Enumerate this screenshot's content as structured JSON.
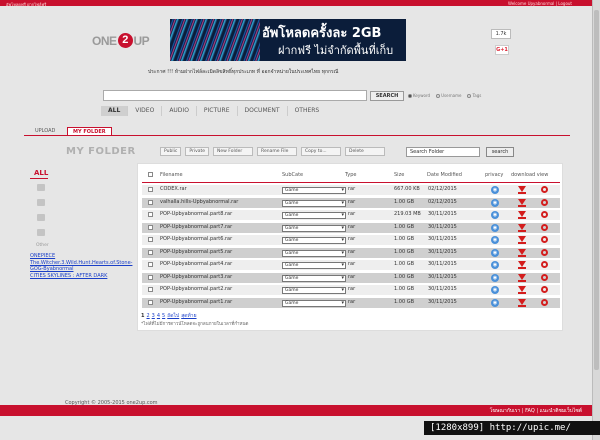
{
  "topbar": {
    "left_text": "อัพโหลดฟรี ฝากไฟล์ฟรี",
    "right_text": "Welcome Upyabnormal | Logout"
  },
  "brand": {
    "logo_left": "ONE",
    "logo_mid": "2",
    "logo_right": "UP"
  },
  "banner": {
    "line1": "อัพโหลดครั้งละ 2GB",
    "line2": "ฝากฟรี ไม่จำกัดพื้นที่เก็บ"
  },
  "social": {
    "like_count": "1.7k",
    "gplus": "G+1"
  },
  "notice": "ประกาศ !!! ห้ามฝากไฟล์ละเมิดลิขสิทธิ์ทุกประเภท ที่ ออกจำหน่ายในประเทศไทย ทุกกรณี",
  "search": {
    "button": "SEARCH",
    "options": [
      "Keyword",
      "Username",
      "Tags"
    ]
  },
  "categories": [
    "ALL",
    "VIDEO",
    "AUDIO",
    "PICTURE",
    "DOCUMENT",
    "OTHERS"
  ],
  "tabs": {
    "upload": "UPLOAD",
    "myfolder": "MY FOLDER"
  },
  "folder": {
    "title": "MY FOLDER",
    "actions": [
      "Public",
      "Private",
      "New Folder",
      "Rename File",
      "Copy to...",
      "Delete"
    ],
    "search_value": "Search  Folder",
    "search_button": "search"
  },
  "sidebar": {
    "all": "ALL",
    "other": "Other",
    "links": [
      "ONEPIECE",
      "The.Witcher.3.Wild.Hunt.Hearts.of.Stone-",
      "GOG-Byabnormal",
      "CITIES SKYLINES : AFTER DARK"
    ]
  },
  "table": {
    "headers": {
      "filename": "Filename",
      "subcate": "SubCate",
      "type": "Type",
      "size": "Size",
      "date": "Date Modified",
      "privacy": "privacy",
      "download_view": "download view"
    },
    "rows": [
      {
        "filename": "CODEX.rar",
        "subcate": "Game",
        "type": "rar",
        "size": "667.00 KB",
        "date": "02/12/2015"
      },
      {
        "filename": "valhalla.hills-Upbyabnormal.rar",
        "subcate": "Game",
        "type": "rar",
        "size": "1.00 GB",
        "date": "02/12/2015"
      },
      {
        "filename": "POP-Upbyabnormal.part8.rar",
        "subcate": "Game",
        "type": "rar",
        "size": "219.03 MB",
        "date": "30/11/2015"
      },
      {
        "filename": "POP-Upbyabnormal.part7.rar",
        "subcate": "Game",
        "type": "rar",
        "size": "1.00 GB",
        "date": "30/11/2015"
      },
      {
        "filename": "POP-Upbyabnormal.part6.rar",
        "subcate": "Game",
        "type": "rar",
        "size": "1.00 GB",
        "date": "30/11/2015"
      },
      {
        "filename": "POP-Upbyabnormal.part5.rar",
        "subcate": "Game",
        "type": "rar",
        "size": "1.00 GB",
        "date": "30/11/2015"
      },
      {
        "filename": "POP-Upbyabnormal.part4.rar",
        "subcate": "Game",
        "type": "rar",
        "size": "1.00 GB",
        "date": "30/11/2015"
      },
      {
        "filename": "POP-Upbyabnormal.part3.rar",
        "subcate": "Game",
        "type": "rar",
        "size": "1.00 GB",
        "date": "30/11/2015"
      },
      {
        "filename": "POP-Upbyabnormal.part2.rar",
        "subcate": "Game",
        "type": "rar",
        "size": "1.00 GB",
        "date": "30/11/2015"
      },
      {
        "filename": "POP-Upbyabnormal.part1.rar",
        "subcate": "Game",
        "type": "rar",
        "size": "1.00 GB",
        "date": "30/11/2015"
      }
    ],
    "pager": [
      "1",
      "2",
      "3",
      "4",
      "5",
      "ถัดไป",
      "สุดท้าย"
    ],
    "note": "*ไฟล์ที่ไม่มีการดาวน์โหลดจะถูกลบภายในเวลาที่กำหนด"
  },
  "footer": {
    "copyright": "Copyright © 2005-2015 one2up.com",
    "links": "โฆษณากับเรา  |  FAQ  |  แนะนำติชมเว็บไซต์"
  },
  "watermark": "[1280x899] http://upic.me/"
}
